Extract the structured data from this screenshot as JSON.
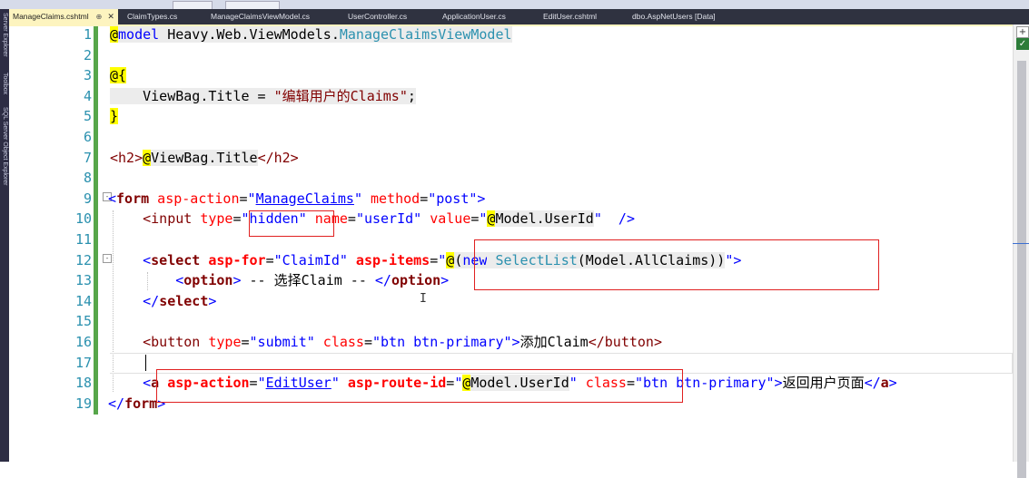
{
  "tabs": [
    {
      "label": "ManageClaims.cshtml",
      "active": true,
      "pin": "⊕",
      "close": "✕"
    },
    {
      "label": "ClaimTypes.cs"
    },
    {
      "label": "ManageClaimsViewModel.cs"
    },
    {
      "label": "UserController.cs"
    },
    {
      "label": "ApplicationUser.cs"
    },
    {
      "label": "EditUser.cshtml"
    },
    {
      "label": "dbo.AspNetUsers [Data]"
    }
  ],
  "side_panels": [
    "Server Explorer",
    "Toolbox",
    "SQL Server Object Explorer"
  ],
  "line_numbers": [
    "1",
    "2",
    "3",
    "4",
    "5",
    "6",
    "7",
    "8",
    "9",
    "10",
    "11",
    "12",
    "13",
    "14",
    "15",
    "16",
    "17",
    "18",
    "19"
  ],
  "code": {
    "l1": {
      "a": "@",
      "b": "model",
      "c": " Heavy.Web.ViewModels.",
      "d": "ManageClaimsViewModel"
    },
    "l3": {
      "a": "@{"
    },
    "l4": {
      "a": "    ViewBag.Title = ",
      "b": "\"编辑用户的Claims\"",
      "c": ";"
    },
    "l5": {
      "a": "}"
    },
    "l7": {
      "a": "<h2>",
      "b": "@",
      "c": "ViewBag.Title",
      "d": "</h2>"
    },
    "l9": {
      "a": "<",
      "b": "form",
      "c": " asp-action",
      "d": "=",
      "e": "\"",
      "f": "ManageClaims",
      "g": "\"",
      "h": " method",
      "i": "=",
      "j": "\"post\"",
      "k": ">"
    },
    "l10": {
      "a": "    <input",
      "b": " type",
      "c": "=",
      "d": "\"hidden\"",
      "e": " name",
      "f": "=",
      "g": "\"userId\"",
      "h": " value",
      "i": "=",
      "j": "\"",
      "k": "@",
      "l": "Model.UserId",
      "m": "\"",
      "n": "  />"
    },
    "l12": {
      "a": "    <",
      "b": "select",
      "c": " asp-for",
      "d": "=",
      "e": "\"ClaimId\"",
      "f": " asp-items",
      "g": "=",
      "h": "\"",
      "i": "@",
      "j": "(",
      "k": "new",
      "l": " ",
      "m": "SelectList",
      "n": "(Model.AllClaims))",
      "o": "\"",
      "p": ">"
    },
    "l13": {
      "a": "        <",
      "b": "option",
      "c": ">",
      "d": " -- 选择Claim -- ",
      "e": "</",
      "f": "option",
      "g": ">"
    },
    "l14": {
      "a": "    </",
      "b": "select",
      "c": ">"
    },
    "l16": {
      "a": "    <button",
      "b": " type",
      "c": "=",
      "d": "\"submit\"",
      "e": " class",
      "f": "=",
      "g": "\"btn btn-primary\"",
      "h": ">",
      "i": "添加Claim",
      "j": "</button>"
    },
    "l18": {
      "a": "    <",
      "b": "a",
      "c": " asp-action",
      "d": "=",
      "e": "\"",
      "f": "EditUser",
      "g": "\"",
      "h": " asp-route-id",
      "i": "=",
      "j": "\"",
      "k": "@",
      "l": "Model.UserId",
      "m": "\"",
      "n": " class",
      "o": "=",
      "p": "\"btn btn-primary\"",
      "q": ">",
      "r": "返回用户页面",
      "s": "</",
      "t": "a",
      "u": ">"
    },
    "l19": {
      "a": "</",
      "b": "form",
      "c": ">"
    }
  },
  "fold_markers": [
    "-",
    "-"
  ],
  "cursor_glyph": "I",
  "scroll_buttons": {
    "add": "+",
    "check": "✓"
  },
  "colors": {
    "keyword": "#0000ff",
    "tag": "#800000",
    "attribute": "#ff0000",
    "type": "#2b91af",
    "razor_highlight": "#ffff00",
    "annotation_box": "#e02020",
    "change_bar": "#57a64a",
    "active_tab": "#fdf4bf"
  }
}
